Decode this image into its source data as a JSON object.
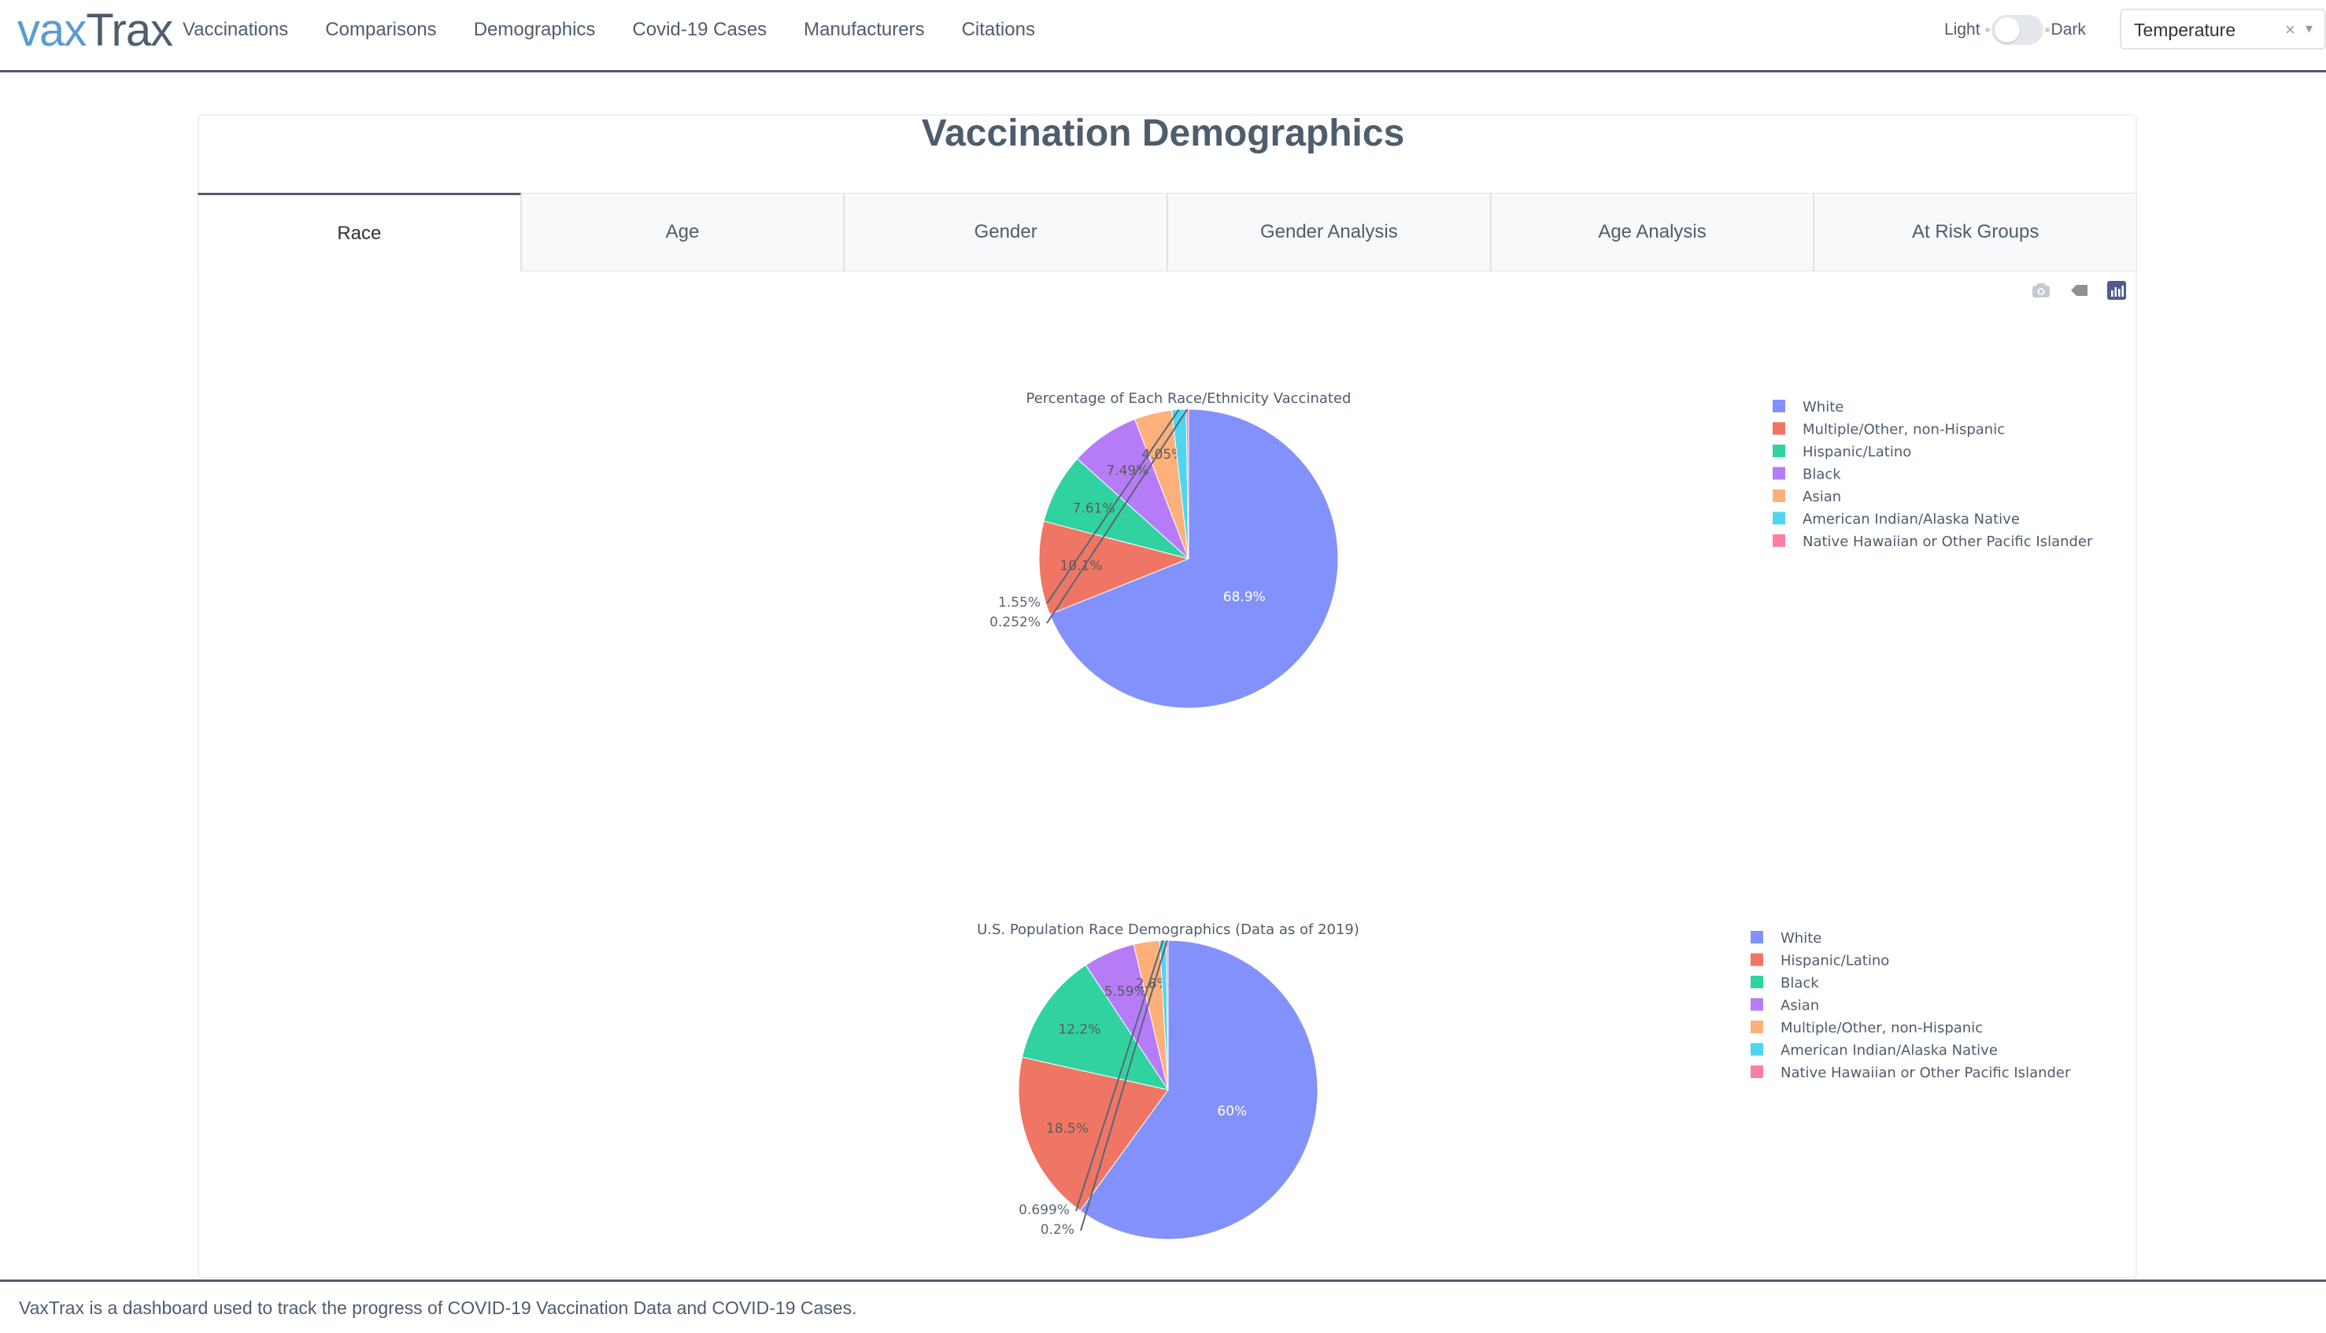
{
  "brand": {
    "part1": "vax",
    "part2": "Trax"
  },
  "nav": {
    "items": [
      "Vaccinations",
      "Comparisons",
      "Demographics",
      "Covid-19 Cases",
      "Manufacturers",
      "Citations"
    ]
  },
  "theme": {
    "light_label": "Light",
    "dark_label": "Dark",
    "mode": "light"
  },
  "metric_select": {
    "value": "Temperature",
    "clear": "×",
    "arrow": "▾"
  },
  "page": {
    "title": "Vaccination Demographics"
  },
  "tabs": [
    "Race",
    "Age",
    "Gender",
    "Gender Analysis",
    "Age Analysis",
    "At Risk Groups"
  ],
  "active_tab": "Race",
  "modebar": [
    "camera-icon",
    "eraser-icon",
    "plotly-logo-icon"
  ],
  "chart_data": [
    {
      "type": "pie",
      "title": "Percentage of Each Race/Ethnicity Vaccinated",
      "legend_position": "right",
      "slices": [
        {
          "label": "White",
          "value": 68.9,
          "text": "68.9%",
          "color": "#8291fb"
        },
        {
          "label": "Multiple/Other, non-Hispanic",
          "value": 10.1,
          "text": "10.1%",
          "color": "#ef7664"
        },
        {
          "label": "Hispanic/Latino",
          "value": 7.61,
          "text": "7.61%",
          "color": "#30d3a0"
        },
        {
          "label": "Black",
          "value": 7.49,
          "text": "7.49%",
          "color": "#b67cf8"
        },
        {
          "label": "Asian",
          "value": 4.05,
          "text": "4.05%",
          "color": "#fdb07a"
        },
        {
          "label": " American Indian/Alaska Native",
          "value": 1.55,
          "text": "1.55%",
          "color": "#4fd6ee"
        },
        {
          "label": "Native Hawaiian or Other Pacific Islander",
          "value": 0.252,
          "text": "0.252%",
          "color": "#fc7fa4"
        }
      ]
    },
    {
      "type": "pie",
      "title": "U.S. Population Race Demographics (Data as of 2019)",
      "legend_position": "right",
      "slices": [
        {
          "label": "White",
          "value": 60,
          "text": "60%",
          "color": "#8291fb"
        },
        {
          "label": "Hispanic/Latino",
          "value": 18.5,
          "text": "18.5%",
          "color": "#ef7664"
        },
        {
          "label": "Black",
          "value": 12.2,
          "text": "12.2%",
          "color": "#30d3a0"
        },
        {
          "label": "Asian",
          "value": 5.59,
          "text": "5.59%",
          "color": "#b67cf8"
        },
        {
          "label": "Multiple/Other, non-Hispanic",
          "value": 2.8,
          "text": "2.8%",
          "color": "#fdb07a"
        },
        {
          "label": " American Indian/Alaska Native",
          "value": 0.699,
          "text": "0.699%",
          "color": "#4fd6ee"
        },
        {
          "label": "Native Hawaiian or Other Pacific Islander",
          "value": 0.2,
          "text": "0.2%",
          "color": "#fc7fa4"
        }
      ]
    }
  ],
  "footer": {
    "text": "VaxTrax is a dashboard used to track the progress of COVID-19 Vaccination Data and COVID-19 Cases."
  }
}
